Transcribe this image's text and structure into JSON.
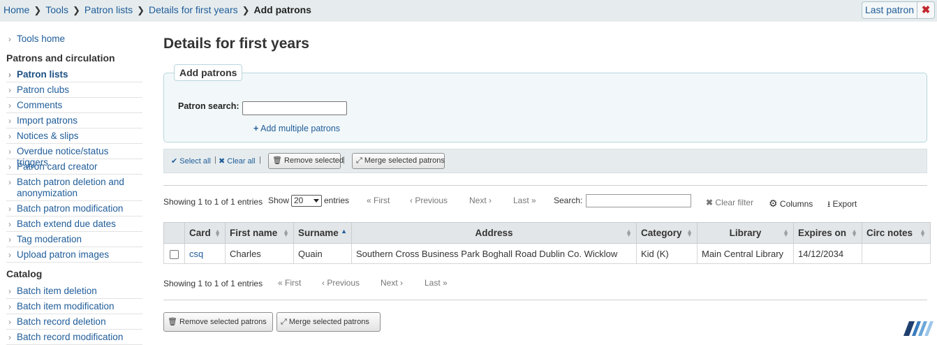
{
  "breadcrumb": {
    "items": [
      "Home",
      "Tools",
      "Patron lists",
      "Details for first years"
    ],
    "current": "Add patrons"
  },
  "header": {
    "last_patron_label": "Last patron",
    "close_glyph": "✖"
  },
  "sidebar": {
    "tools_home": "Tools home",
    "section1": "Patrons and circulation",
    "items1": [
      "Patron lists",
      "Patron clubs",
      "Comments",
      "Import patrons",
      "Notices & slips",
      "Overdue notice/status triggers",
      "Patron card creator",
      "Batch patron deletion and anonymization",
      "Batch patron modification",
      "Batch extend due dates",
      "Tag moderation",
      "Upload patron images"
    ],
    "section2": "Catalog",
    "items2": [
      "Batch item deletion",
      "Batch item modification",
      "Batch record deletion",
      "Batch record modification"
    ]
  },
  "main": {
    "title": "Details for first years",
    "add_patrons": {
      "legend": "Add patrons",
      "search_label": "Patron search:",
      "search_value": "",
      "add_multiple": "Add multiple patrons"
    },
    "toolbar": {
      "select_all": "Select all",
      "clear_all": "Clear all",
      "remove_selected": "Remove selected",
      "merge_selected": "Merge selected patrons"
    },
    "table_controls": {
      "showing": "Showing 1 to 1 of 1 entries",
      "show_label": "Show",
      "show_value": "20",
      "entries_label": "entries",
      "first": "« First",
      "previous": "‹ Previous",
      "next": "Next ›",
      "last": "Last »",
      "search_label": "Search:",
      "search_value": "",
      "clear_filter": "Clear filter",
      "columns": "Columns",
      "export": "Export"
    },
    "table": {
      "headers": [
        "Card",
        "First name",
        "Surname",
        "Address",
        "Category",
        "Library",
        "Expires on",
        "Circ notes"
      ],
      "rows": [
        {
          "card": "csq",
          "first_name": "Charles",
          "surname": "Quain",
          "address": "Southern Cross Business Park Boghall Road Dublin Co. Wicklow",
          "category": "Kid (K)",
          "library": "Main Central Library",
          "expires_on": "14/12/2034",
          "circ_notes": ""
        }
      ]
    },
    "bottom": {
      "showing": "Showing 1 to 1 of 1 entries",
      "first": "« First",
      "previous": "‹ Previous",
      "next": "Next ›",
      "last": "Last »",
      "remove_selected_patrons": "Remove selected patrons",
      "merge_selected_patrons": "Merge selected patrons"
    }
  },
  "icons": {
    "breadcrumb_separator": "chevron-right-icon",
    "add": "plus-icon",
    "check": "check-icon",
    "clear": "x-icon",
    "trash": "trash-icon",
    "merge": "compress-icon",
    "clear_filter": "x-icon",
    "columns": "gear-icon",
    "export": "download-icon",
    "logo": "koha-logo"
  },
  "colors": {
    "link": "#1f5c99",
    "bar": "#e6ecee",
    "fieldset": "#f2f8f9",
    "close": "#c1272d"
  }
}
